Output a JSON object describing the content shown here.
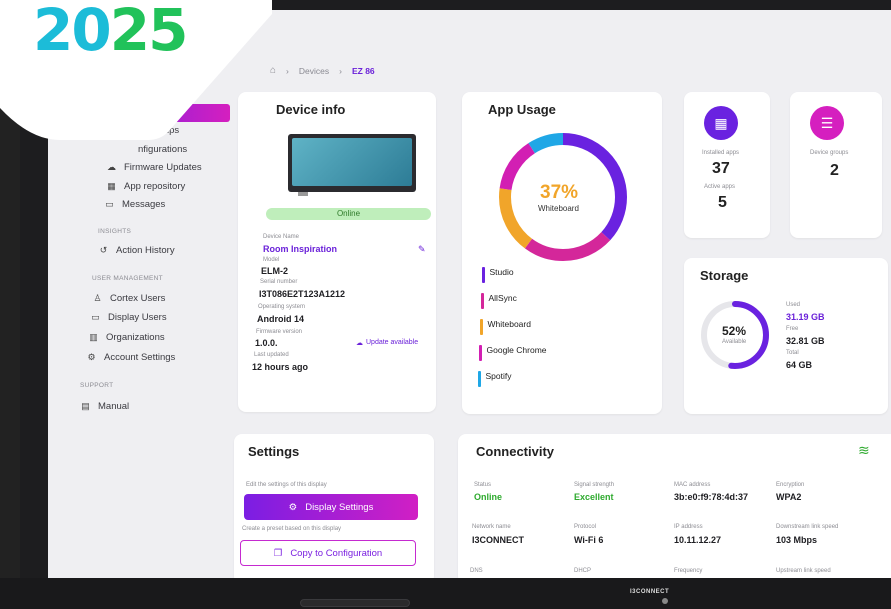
{
  "banner": {
    "year_part1": "20",
    "year_part2": "25"
  },
  "breadcrumb": {
    "devices": "Devices",
    "current": "EZ 86"
  },
  "sidebar": {
    "groups_partial": "Groups",
    "configurations_partial": "nfigurations",
    "firmware_updates": "Firmware Updates",
    "app_repository": "App repository",
    "messages": "Messages",
    "section_insights": "INSIGHTS",
    "action_history": "Action History",
    "section_user_mgmt": "USER MANAGEMENT",
    "cortex_users": "Cortex Users",
    "display_users": "Display Users",
    "organizations": "Organizations",
    "account_settings": "Account Settings",
    "section_support": "SUPPORT",
    "manual": "Manual"
  },
  "device_info": {
    "title": "Device info",
    "status": "Online",
    "device_name_label": "Device Name",
    "device_name": "Room Inspiration",
    "model_label": "Model",
    "model": "ELM-2",
    "serial_label": "Serial number",
    "serial": "I3T086E2T123A1212",
    "os_label": "Operating system",
    "os": "Android 14",
    "firmware_label": "Firmware version",
    "firmware": "1.0.0.",
    "update_available": "Update available",
    "last_updated_label": "Last updated",
    "last_updated": "12 hours ago"
  },
  "app_usage": {
    "title": "App Usage",
    "percent": "37%",
    "center_label": "Whiteboard",
    "apps": [
      {
        "name": "Studio",
        "color": "#6a22e0"
      },
      {
        "name": "AllSync",
        "color": "#d4279a"
      },
      {
        "name": "Whiteboard",
        "color": "#f1a52a"
      },
      {
        "name": "Google Chrome",
        "color": "#d21fb3"
      },
      {
        "name": "Spotify",
        "color": "#1fa7e6"
      }
    ]
  },
  "stats": {
    "installed_label": "Installed apps",
    "installed": "37",
    "active_label": "Active apps",
    "active": "5",
    "groups_label": "Device groups",
    "groups": "2"
  },
  "storage": {
    "title": "Storage",
    "percent": "52%",
    "available_label": "Available",
    "used_label": "Used",
    "used": "31.19 GB",
    "free_label": "Free",
    "free": "32.81 GB",
    "total_label": "Total",
    "total": "64 GB"
  },
  "settings": {
    "title": "Settings",
    "edit_hint": "Edit the settings of this display",
    "display_settings": "Display Settings",
    "preset_hint": "Create a preset based on this display",
    "copy_config": "Copy to Configuration"
  },
  "connectivity": {
    "title": "Connectivity",
    "status_label": "Status",
    "status": "Online",
    "signal_label": "Signal strength",
    "signal": "Excellent",
    "mac_label": "MAC address",
    "mac": "3b:e0:f9:78:4d:37",
    "encryption_label": "Encryption",
    "encryption": "WPA2",
    "network_label": "Network name",
    "network": "I3CONNECT",
    "protocol_label": "Protocol",
    "protocol": "Wi-Fi 6",
    "ip_label": "IP address",
    "ip": "10.11.12.27",
    "downstream_label": "Downstream link speed",
    "downstream": "103 Mbps",
    "dns_label": "DNS",
    "dhcp_label": "DHCP",
    "frequency_label": "Frequency",
    "upstream_label": "Upstream link speed"
  },
  "bezel": {
    "brand": "I3CONNECT"
  },
  "colors": {
    "accent": "#6b22d9",
    "magenta": "#d11fc4",
    "online": "#2eaa2e"
  }
}
